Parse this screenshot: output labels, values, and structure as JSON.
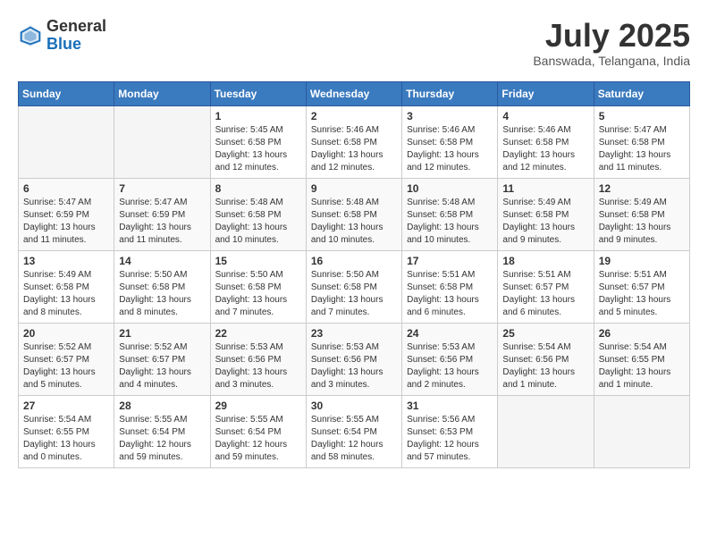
{
  "header": {
    "logo_general": "General",
    "logo_blue": "Blue",
    "month_title": "July 2025",
    "location": "Banswada, Telangana, India"
  },
  "days_of_week": [
    "Sunday",
    "Monday",
    "Tuesday",
    "Wednesday",
    "Thursday",
    "Friday",
    "Saturday"
  ],
  "weeks": [
    [
      {
        "day": "",
        "info": ""
      },
      {
        "day": "",
        "info": ""
      },
      {
        "day": "1",
        "info": "Sunrise: 5:45 AM\nSunset: 6:58 PM\nDaylight: 13 hours and 12 minutes."
      },
      {
        "day": "2",
        "info": "Sunrise: 5:46 AM\nSunset: 6:58 PM\nDaylight: 13 hours and 12 minutes."
      },
      {
        "day": "3",
        "info": "Sunrise: 5:46 AM\nSunset: 6:58 PM\nDaylight: 13 hours and 12 minutes."
      },
      {
        "day": "4",
        "info": "Sunrise: 5:46 AM\nSunset: 6:58 PM\nDaylight: 13 hours and 12 minutes."
      },
      {
        "day": "5",
        "info": "Sunrise: 5:47 AM\nSunset: 6:58 PM\nDaylight: 13 hours and 11 minutes."
      }
    ],
    [
      {
        "day": "6",
        "info": "Sunrise: 5:47 AM\nSunset: 6:59 PM\nDaylight: 13 hours and 11 minutes."
      },
      {
        "day": "7",
        "info": "Sunrise: 5:47 AM\nSunset: 6:59 PM\nDaylight: 13 hours and 11 minutes."
      },
      {
        "day": "8",
        "info": "Sunrise: 5:48 AM\nSunset: 6:58 PM\nDaylight: 13 hours and 10 minutes."
      },
      {
        "day": "9",
        "info": "Sunrise: 5:48 AM\nSunset: 6:58 PM\nDaylight: 13 hours and 10 minutes."
      },
      {
        "day": "10",
        "info": "Sunrise: 5:48 AM\nSunset: 6:58 PM\nDaylight: 13 hours and 10 minutes."
      },
      {
        "day": "11",
        "info": "Sunrise: 5:49 AM\nSunset: 6:58 PM\nDaylight: 13 hours and 9 minutes."
      },
      {
        "day": "12",
        "info": "Sunrise: 5:49 AM\nSunset: 6:58 PM\nDaylight: 13 hours and 9 minutes."
      }
    ],
    [
      {
        "day": "13",
        "info": "Sunrise: 5:49 AM\nSunset: 6:58 PM\nDaylight: 13 hours and 8 minutes."
      },
      {
        "day": "14",
        "info": "Sunrise: 5:50 AM\nSunset: 6:58 PM\nDaylight: 13 hours and 8 minutes."
      },
      {
        "day": "15",
        "info": "Sunrise: 5:50 AM\nSunset: 6:58 PM\nDaylight: 13 hours and 7 minutes."
      },
      {
        "day": "16",
        "info": "Sunrise: 5:50 AM\nSunset: 6:58 PM\nDaylight: 13 hours and 7 minutes."
      },
      {
        "day": "17",
        "info": "Sunrise: 5:51 AM\nSunset: 6:58 PM\nDaylight: 13 hours and 6 minutes."
      },
      {
        "day": "18",
        "info": "Sunrise: 5:51 AM\nSunset: 6:57 PM\nDaylight: 13 hours and 6 minutes."
      },
      {
        "day": "19",
        "info": "Sunrise: 5:51 AM\nSunset: 6:57 PM\nDaylight: 13 hours and 5 minutes."
      }
    ],
    [
      {
        "day": "20",
        "info": "Sunrise: 5:52 AM\nSunset: 6:57 PM\nDaylight: 13 hours and 5 minutes."
      },
      {
        "day": "21",
        "info": "Sunrise: 5:52 AM\nSunset: 6:57 PM\nDaylight: 13 hours and 4 minutes."
      },
      {
        "day": "22",
        "info": "Sunrise: 5:53 AM\nSunset: 6:56 PM\nDaylight: 13 hours and 3 minutes."
      },
      {
        "day": "23",
        "info": "Sunrise: 5:53 AM\nSunset: 6:56 PM\nDaylight: 13 hours and 3 minutes."
      },
      {
        "day": "24",
        "info": "Sunrise: 5:53 AM\nSunset: 6:56 PM\nDaylight: 13 hours and 2 minutes."
      },
      {
        "day": "25",
        "info": "Sunrise: 5:54 AM\nSunset: 6:56 PM\nDaylight: 13 hours and 1 minute."
      },
      {
        "day": "26",
        "info": "Sunrise: 5:54 AM\nSunset: 6:55 PM\nDaylight: 13 hours and 1 minute."
      }
    ],
    [
      {
        "day": "27",
        "info": "Sunrise: 5:54 AM\nSunset: 6:55 PM\nDaylight: 13 hours and 0 minutes."
      },
      {
        "day": "28",
        "info": "Sunrise: 5:55 AM\nSunset: 6:54 PM\nDaylight: 12 hours and 59 minutes."
      },
      {
        "day": "29",
        "info": "Sunrise: 5:55 AM\nSunset: 6:54 PM\nDaylight: 12 hours and 59 minutes."
      },
      {
        "day": "30",
        "info": "Sunrise: 5:55 AM\nSunset: 6:54 PM\nDaylight: 12 hours and 58 minutes."
      },
      {
        "day": "31",
        "info": "Sunrise: 5:56 AM\nSunset: 6:53 PM\nDaylight: 12 hours and 57 minutes."
      },
      {
        "day": "",
        "info": ""
      },
      {
        "day": "",
        "info": ""
      }
    ]
  ]
}
